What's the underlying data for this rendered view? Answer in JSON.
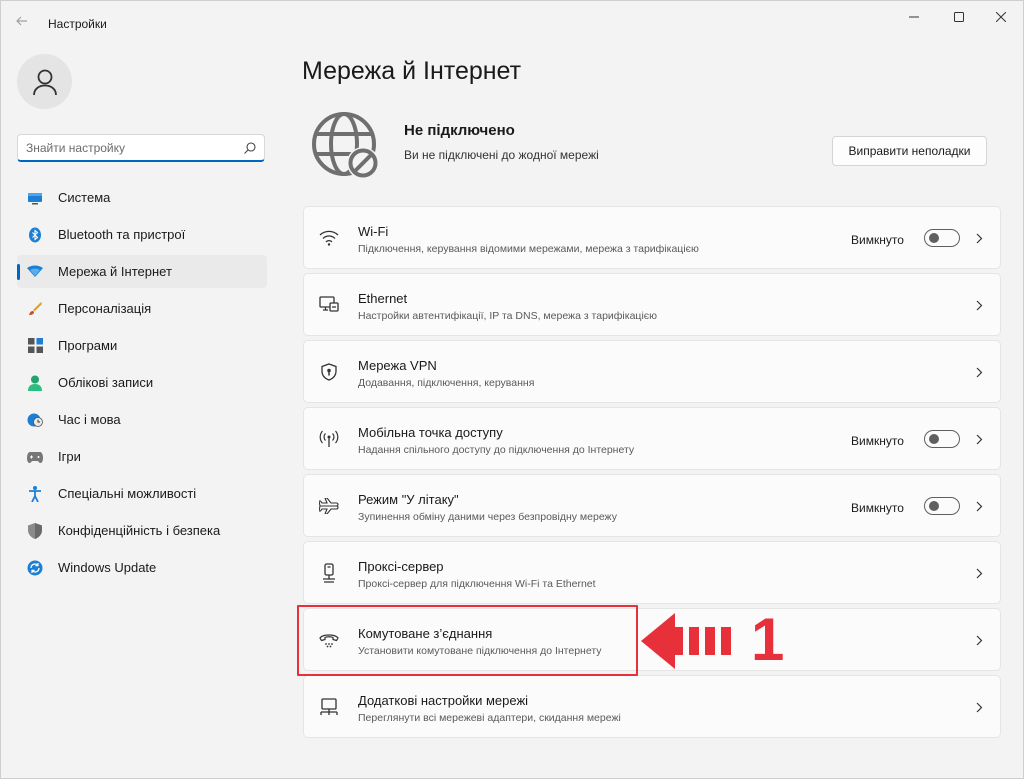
{
  "window": {
    "title": "Настройки",
    "back_icon": "back-arrow-icon",
    "controls": [
      "minimize-icon",
      "maximize-icon",
      "close-icon"
    ]
  },
  "sidebar": {
    "avatar_icon": "user-icon",
    "search": {
      "placeholder": "Знайти настройку",
      "icon": "search-icon",
      "accent": "#0067c0"
    },
    "items": [
      {
        "label": "Система",
        "icon": "system-display-icon",
        "active": false
      },
      {
        "label": "Bluetooth та пристрої",
        "icon": "bluetooth-icon",
        "active": false
      },
      {
        "label": "Мережа й Інтернет",
        "icon": "network-wifi-icon",
        "active": true
      },
      {
        "label": "Персоналізація",
        "icon": "brush-icon",
        "active": false
      },
      {
        "label": "Програми",
        "icon": "apps-icon",
        "active": false
      },
      {
        "label": "Облікові записи",
        "icon": "accounts-icon",
        "active": false
      },
      {
        "label": "Час і мова",
        "icon": "time-language-icon",
        "active": false
      },
      {
        "label": "Ігри",
        "icon": "gamepad-icon",
        "active": false
      },
      {
        "label": "Спеціальні можливості",
        "icon": "accessibility-icon",
        "active": false
      },
      {
        "label": "Конфіденційність і безпека",
        "icon": "shield-icon",
        "active": false
      },
      {
        "label": "Windows Update",
        "icon": "windows-update-icon",
        "active": false
      }
    ]
  },
  "main": {
    "title": "Мережа й Інтернет",
    "status": {
      "icon": "globe-disconnected-icon",
      "title": "Не підключено",
      "subtitle": "Ви не підключені до жодної мережі",
      "fix_button": "Виправити неполадки"
    },
    "cards": [
      {
        "title": "Wi-Fi",
        "subtitle": "Підключення, керування відомими мережами, мережа з тарифікацією",
        "icon": "wifi-icon",
        "state": "Вимкнуто",
        "toggle_on": false
      },
      {
        "title": "Ethernet",
        "subtitle": "Настройки автентифікації, IP та DNS, мережа з тарифікацією",
        "icon": "ethernet-icon"
      },
      {
        "title": "Мережа VPN",
        "subtitle": "Додавання, підключення, керування",
        "icon": "vpn-shield-icon"
      },
      {
        "title": "Мобільна точка доступу",
        "subtitle": "Надання спільного доступу до підключення до Інтернету",
        "icon": "hotspot-icon",
        "state": "Вимкнуто",
        "toggle_on": false
      },
      {
        "title": "Режим \"У літаку\"",
        "subtitle": "Зупинення обміну даними через безпровідну мережу",
        "icon": "airplane-icon",
        "state": "Вимкнуто",
        "toggle_on": false
      },
      {
        "title": "Проксі-сервер",
        "subtitle": "Проксі-сервер для підключення Wi-Fi та Ethernet",
        "icon": "proxy-icon"
      },
      {
        "title": "Комутоване з’єднання",
        "subtitle": "Установити комутоване підключення до Інтернету",
        "icon": "dialup-phone-icon"
      },
      {
        "title": "Додаткові настройки мережі",
        "subtitle": "Переглянути всі мережеві адаптери, скидання мережі",
        "icon": "network-adapter-icon"
      }
    ]
  },
  "annotation": {
    "number": "1",
    "color": "#e8303a",
    "arrow_icon": "red-arrow-left-icon"
  }
}
